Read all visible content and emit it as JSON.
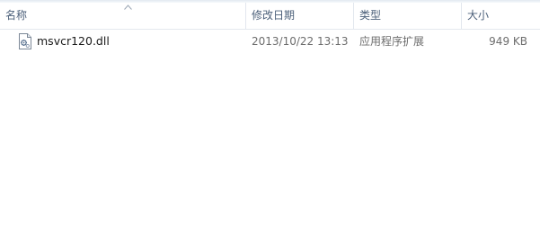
{
  "columns": {
    "name": "名称",
    "date": "修改日期",
    "type": "类型",
    "size": "大小"
  },
  "files": [
    {
      "name": "msvcr120.dll",
      "date": "2013/10/22 13:13",
      "type": "应用程序扩展",
      "size": "949 KB",
      "icon": "dll-file-icon"
    }
  ],
  "sort": {
    "column": "name",
    "direction": "ascending",
    "icon": "sort-up-arrow-icon"
  }
}
